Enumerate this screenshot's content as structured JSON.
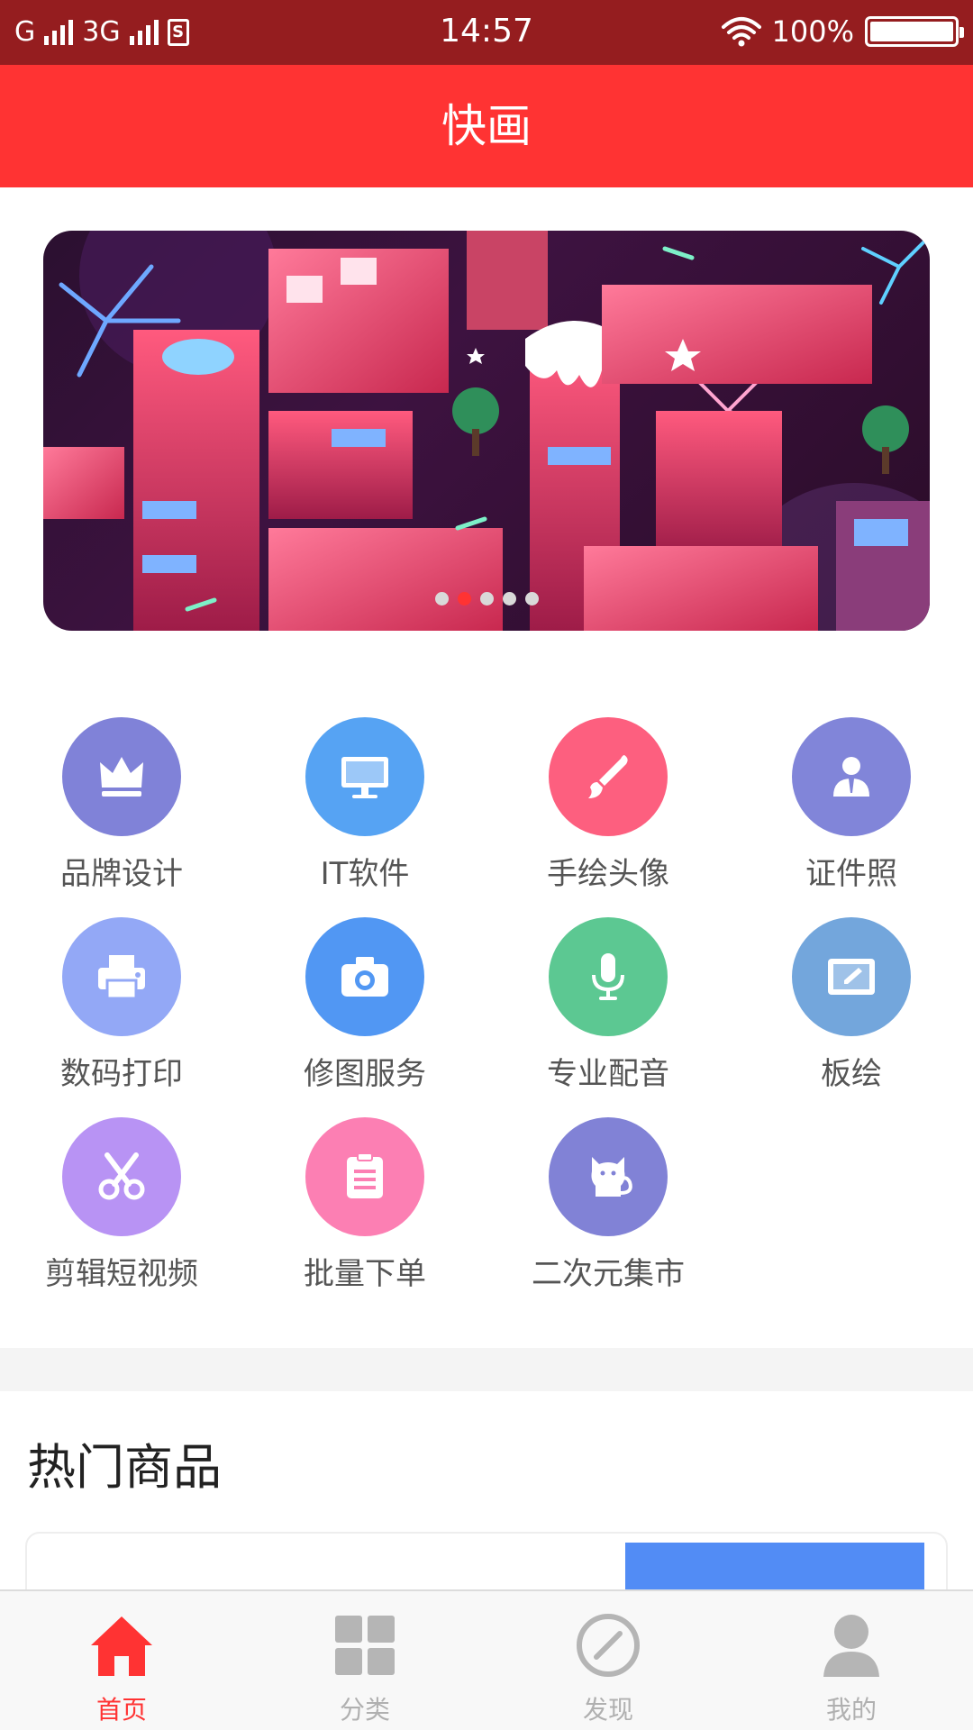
{
  "status_bar": {
    "network1": "G",
    "network2": "3G",
    "time": "14:57",
    "battery": "100%",
    "battery_level": 1.0
  },
  "header": {
    "title": "快画"
  },
  "banner": {
    "slide_count": 5,
    "active_index": 1
  },
  "categories": [
    {
      "label": "品牌设计",
      "icon": "crown-icon",
      "color": "#8082d8"
    },
    {
      "label": "IT软件",
      "icon": "monitor-icon",
      "color": "#56a3f3"
    },
    {
      "label": "手绘头像",
      "icon": "brush-icon",
      "color": "#fd5f7f"
    },
    {
      "label": "证件照",
      "icon": "id-photo-icon",
      "color": "#8185d9"
    },
    {
      "label": "数码打印",
      "icon": "printer-icon",
      "color": "#93a8f6"
    },
    {
      "label": "修图服务",
      "icon": "camera-icon",
      "color": "#5197f3"
    },
    {
      "label": "专业配音",
      "icon": "microphone-icon",
      "color": "#5cc892"
    },
    {
      "label": "板绘",
      "icon": "tablet-icon",
      "color": "#73a6dc"
    },
    {
      "label": "剪辑短视频",
      "icon": "scissors-icon",
      "color": "#b893f4"
    },
    {
      "label": "批量下单",
      "icon": "clipboard-icon",
      "color": "#fc7fb3"
    },
    {
      "label": "二次元集市",
      "icon": "cat-icon",
      "color": "#8182d6"
    }
  ],
  "hot_section": {
    "title": "热门商品"
  },
  "tabs": [
    {
      "label": "首页",
      "icon": "home-icon",
      "active": true
    },
    {
      "label": "分类",
      "icon": "grid-icon",
      "active": false
    },
    {
      "label": "发现",
      "icon": "compass-icon",
      "active": false
    },
    {
      "label": "我的",
      "icon": "user-icon",
      "active": false
    }
  ],
  "colors": {
    "brand_red": "#ff3333",
    "status_bar": "#951d1f",
    "inactive_gray": "#b0b0b0"
  }
}
